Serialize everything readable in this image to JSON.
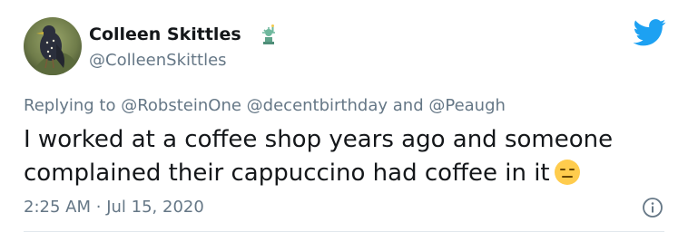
{
  "user": {
    "display_name": "Colleen Skittles",
    "handle": "@ColleenSkittles",
    "badge_icon": "statue-of-liberty-emoji"
  },
  "reply": {
    "prefix": "Replying to",
    "mentions": [
      "@RobsteinOne",
      "@decentbirthday",
      "@Peaugh"
    ],
    "joiner": "and"
  },
  "tweet": {
    "lines": [
      "I worked at a coffee shop years ago and someone",
      "complained their cappuccino had coffee in it"
    ],
    "emoji": "expressionless-face-emoji"
  },
  "meta": {
    "time": "2:25 AM",
    "separator": "·",
    "date": "Jul 15, 2020"
  },
  "colors": {
    "twitter_blue": "#1da1f2",
    "secondary_text": "#657786",
    "primary_text": "#14171a"
  }
}
